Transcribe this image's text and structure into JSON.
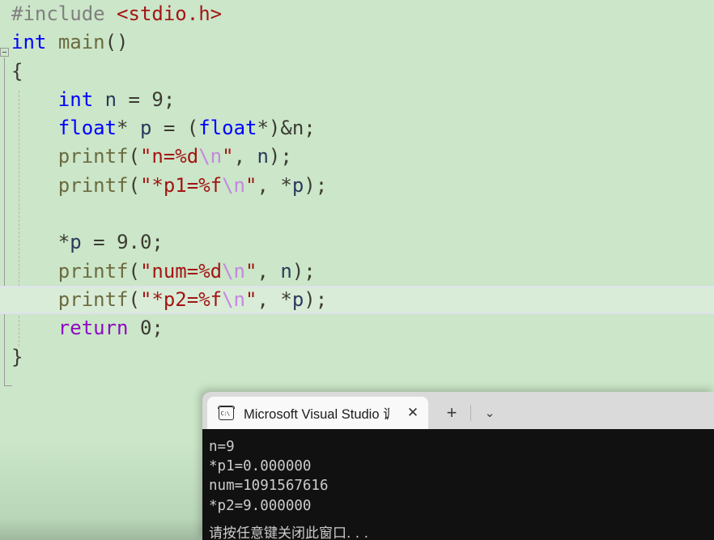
{
  "editor": {
    "background_color": "#cbe6c8",
    "current_line_color": "#d9ecd7",
    "language": "c",
    "lines": [
      {
        "index": 1,
        "text": "#include <stdio.h>",
        "tokens": [
          {
            "t": "#include",
            "c": "tok-pre"
          },
          {
            "t": " ",
            "c": "tok-plain"
          },
          {
            "t": "<stdio.h>",
            "c": "tok-str"
          }
        ]
      },
      {
        "index": 2,
        "text": "int main()",
        "tokens": [
          {
            "t": "int",
            "c": "tok-kw"
          },
          {
            "t": " ",
            "c": "tok-plain"
          },
          {
            "t": "main",
            "c": "tok-fn"
          },
          {
            "t": "()",
            "c": "tok-punct"
          }
        ]
      },
      {
        "index": 3,
        "text": "{",
        "tokens": [
          {
            "t": "{",
            "c": "tok-punct"
          }
        ]
      },
      {
        "index": 4,
        "text": "    int n = 9;",
        "tokens": [
          {
            "t": "    ",
            "c": "tok-plain"
          },
          {
            "t": "int",
            "c": "tok-kw"
          },
          {
            "t": " ",
            "c": "tok-plain"
          },
          {
            "t": "n",
            "c": "tok-var"
          },
          {
            "t": " = ",
            "c": "tok-plain"
          },
          {
            "t": "9",
            "c": "tok-num"
          },
          {
            "t": ";",
            "c": "tok-punct"
          }
        ]
      },
      {
        "index": 5,
        "text": "    float* p = (float*)&n;",
        "tokens": [
          {
            "t": "    ",
            "c": "tok-plain"
          },
          {
            "t": "float",
            "c": "tok-kw"
          },
          {
            "t": "* ",
            "c": "tok-plain"
          },
          {
            "t": "p",
            "c": "tok-var"
          },
          {
            "t": " = ",
            "c": "tok-plain"
          },
          {
            "t": "(",
            "c": "tok-punct"
          },
          {
            "t": "float",
            "c": "tok-kw"
          },
          {
            "t": "*)",
            "c": "tok-punct"
          },
          {
            "t": "&n",
            "c": "tok-plain"
          },
          {
            "t": ";",
            "c": "tok-punct"
          }
        ]
      },
      {
        "index": 6,
        "text": "    printf(\"n=%d\\n\", n);",
        "tokens": [
          {
            "t": "    ",
            "c": "tok-plain"
          },
          {
            "t": "printf",
            "c": "tok-fn"
          },
          {
            "t": "(",
            "c": "tok-punct"
          },
          {
            "t": "\"n=%d",
            "c": "tok-str"
          },
          {
            "t": "\\n",
            "c": "tok-esc"
          },
          {
            "t": "\"",
            "c": "tok-str"
          },
          {
            "t": ", ",
            "c": "tok-punct"
          },
          {
            "t": "n",
            "c": "tok-var"
          },
          {
            "t": ");",
            "c": "tok-punct"
          }
        ]
      },
      {
        "index": 7,
        "text": "    printf(\"*p1=%f\\n\", *p);",
        "tokens": [
          {
            "t": "    ",
            "c": "tok-plain"
          },
          {
            "t": "printf",
            "c": "tok-fn"
          },
          {
            "t": "(",
            "c": "tok-punct"
          },
          {
            "t": "\"*p1=%f",
            "c": "tok-str"
          },
          {
            "t": "\\n",
            "c": "tok-esc"
          },
          {
            "t": "\"",
            "c": "tok-str"
          },
          {
            "t": ", ",
            "c": "tok-punct"
          },
          {
            "t": "*",
            "c": "tok-plain"
          },
          {
            "t": "p",
            "c": "tok-var"
          },
          {
            "t": ");",
            "c": "tok-punct"
          }
        ]
      },
      {
        "index": 8,
        "text": "",
        "tokens": []
      },
      {
        "index": 9,
        "text": "    *p = 9.0;",
        "tokens": [
          {
            "t": "    ",
            "c": "tok-plain"
          },
          {
            "t": "*",
            "c": "tok-plain"
          },
          {
            "t": "p",
            "c": "tok-var"
          },
          {
            "t": " = ",
            "c": "tok-plain"
          },
          {
            "t": "9.0",
            "c": "tok-num"
          },
          {
            "t": ";",
            "c": "tok-punct"
          }
        ]
      },
      {
        "index": 10,
        "text": "    printf(\"num=%d\\n\", n);",
        "tokens": [
          {
            "t": "    ",
            "c": "tok-plain"
          },
          {
            "t": "printf",
            "c": "tok-fn"
          },
          {
            "t": "(",
            "c": "tok-punct"
          },
          {
            "t": "\"num=%d",
            "c": "tok-str"
          },
          {
            "t": "\\n",
            "c": "tok-esc"
          },
          {
            "t": "\"",
            "c": "tok-str"
          },
          {
            "t": ", ",
            "c": "tok-punct"
          },
          {
            "t": "n",
            "c": "tok-var"
          },
          {
            "t": ");",
            "c": "tok-punct"
          }
        ]
      },
      {
        "index": 11,
        "text": "    printf(\"*p2=%f\\n\", *p);",
        "current": true,
        "tokens": [
          {
            "t": "    ",
            "c": "tok-plain"
          },
          {
            "t": "printf",
            "c": "tok-fn"
          },
          {
            "t": "(",
            "c": "tok-punct"
          },
          {
            "t": "\"*p2=%f",
            "c": "tok-str"
          },
          {
            "t": "\\n",
            "c": "tok-esc"
          },
          {
            "t": "\"",
            "c": "tok-str"
          },
          {
            "t": ", ",
            "c": "tok-punct"
          },
          {
            "t": "*",
            "c": "tok-plain"
          },
          {
            "t": "p",
            "c": "tok-var"
          },
          {
            "t": ");",
            "c": "tok-punct"
          }
        ]
      },
      {
        "index": 12,
        "text": "    return 0;",
        "tokens": [
          {
            "t": "    ",
            "c": "tok-plain"
          },
          {
            "t": "return",
            "c": "tok-kw2"
          },
          {
            "t": " ",
            "c": "tok-plain"
          },
          {
            "t": "0",
            "c": "tok-num"
          },
          {
            "t": ";",
            "c": "tok-punct"
          }
        ]
      },
      {
        "index": 13,
        "text": "}",
        "tokens": [
          {
            "t": "}",
            "c": "tok-punct"
          }
        ]
      }
    ],
    "gutter": {
      "fold_marker": "collapse-minus-icon"
    }
  },
  "terminal": {
    "tab": {
      "title": "Microsoft Visual Studio 调试挖",
      "icon": "command-prompt-icon",
      "close_label": "✕"
    },
    "new_tab_label": "+",
    "dropdown_label": "⌄",
    "background_color": "#111111",
    "output_lines": [
      "n=9",
      "*p1=0.000000",
      "num=1091567616",
      "*p2=9.000000"
    ],
    "clipped_line": "请按任意键关闭此窗口. . ."
  }
}
